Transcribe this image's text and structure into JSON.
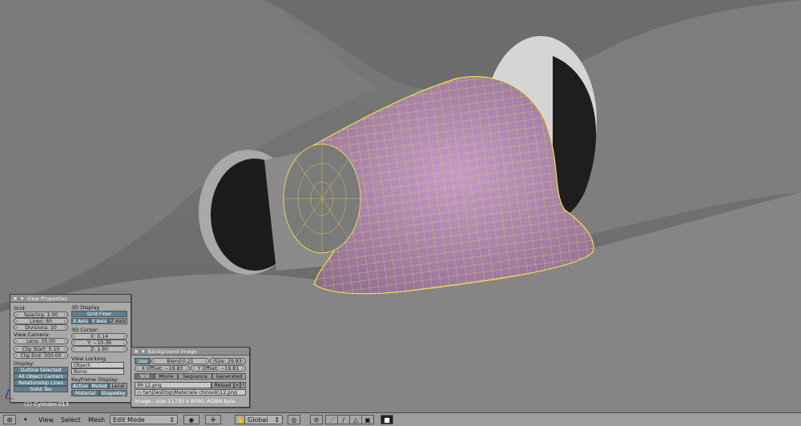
{
  "view_properties": {
    "title": "View Properties",
    "grid_heading": "Grid:",
    "spacing": "Spacing: 1.00",
    "lines": "Lines: 60",
    "divisions": "Divisions: 10",
    "view_camera_heading": "View Camera:",
    "lens": "Lens: 35.00",
    "clip_start": "Clip Start: 0.10",
    "clip_end": "Clip End: 500.00",
    "display_heading": "Display:",
    "outline_selected": "Outline Selected",
    "all_object_centers": "All Object Centers",
    "relationship_lines": "Relationship Lines",
    "solid_tex": "Solid Tex",
    "display3d_heading": "3D Display",
    "grid_floor": "Grid Floor",
    "x_axis": "X Axis",
    "y_axis": "Y Axis",
    "z_axis": "Z Axis",
    "cursor_heading": "3D Cursor:",
    "cursor_x": "X: 0.14",
    "cursor_y": "Y: −10.36",
    "cursor_z": "Z: 1.90",
    "view_locking_heading": "View Locking:",
    "object_field": "Object:",
    "bone_field": "Bone:",
    "keyframe_heading": "Keyframe Display:",
    "kf_active": "Active",
    "kf_muted": "Muted",
    "kf_local": "Local",
    "kf_material": "Material",
    "kf_shapekey": "ShapeKey"
  },
  "background_image": {
    "title": "Background Image",
    "use": "Use",
    "blend": "Blend:0.21",
    "size": "Size: 29.83",
    "x_offset": "X Offset: −19.83",
    "y_offset": "Y Offset: −19.81",
    "tab_still": "Still",
    "tab_movie": "Movie",
    "tab_sequence": "Sequence",
    "tab_generated": "Generated",
    "image_name": "IM:12.png",
    "reload": "Reload",
    "path": "ter\\Desktop\\Materiale chinook\\12.png",
    "image_info": "Image : size 11730 x 8000, RGBA byte"
  },
  "status": {
    "object_label": "(1) Cylinder.013"
  },
  "header": {
    "menu_view": "View",
    "menu_select": "Select",
    "menu_mesh": "Mesh",
    "mode": "Edit Mode",
    "orientation": "Global"
  }
}
